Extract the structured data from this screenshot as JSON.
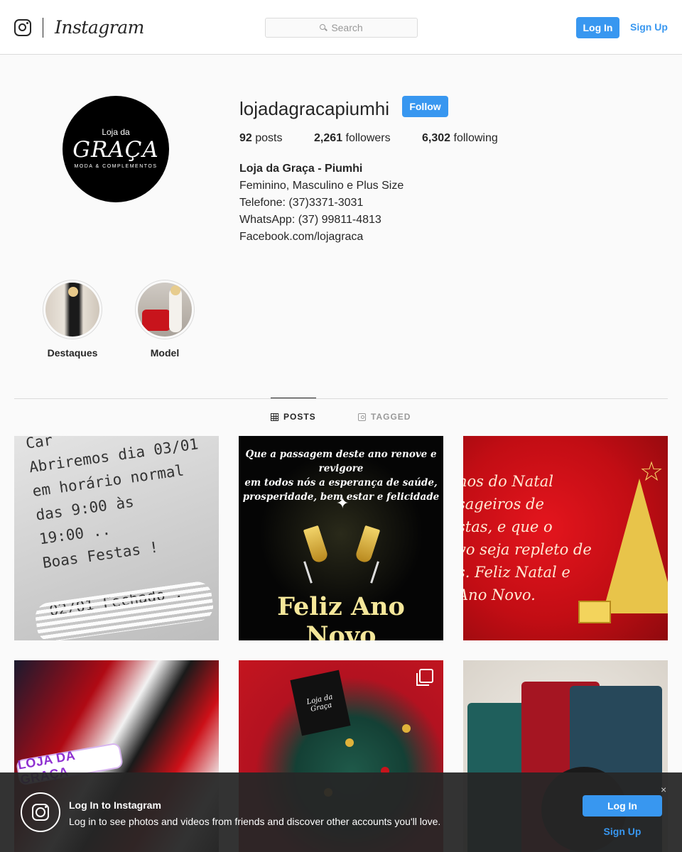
{
  "header": {
    "wordmark": "Instagram",
    "search_placeholder": "Search",
    "login_label": "Log In",
    "signup_label": "Sign Up"
  },
  "profile": {
    "avatar": {
      "line1": "Loja da",
      "line2": "GRAÇA",
      "line3": "MODA & COMPLEMENTOS"
    },
    "username": "lojadagracapiumhi",
    "follow_label": "Follow",
    "stats": [
      {
        "count": "92",
        "label": "posts"
      },
      {
        "count": "2,261",
        "label": "followers"
      },
      {
        "count": "6,302",
        "label": "following"
      }
    ],
    "bio": {
      "name": "Loja da Graça - Piumhi",
      "lines": [
        "Feminino, Masculino e Plus Size",
        "Telefone: (37)3371-3031",
        "WhatsApp: (37) 99811-4813",
        "Facebook.com/lojagraca"
      ]
    }
  },
  "highlights": [
    {
      "label": "Destaques"
    },
    {
      "label": "Model"
    }
  ],
  "tabs": [
    {
      "label": "POSTS",
      "active": true
    },
    {
      "label": "TAGGED",
      "active": false
    }
  ],
  "posts": {
    "p1_text": "Car\nAbriremos dia 03/01\nem horário normal\ndas 9:00 às\n19:00 ..\nBoas Festas !\n\n02/01 Fechado .",
    "p2_top": "Que a passagem deste ano renove e revigore\nem todos nós a esperança de saúde,\nprosperidade, bem estar e felicidade",
    "p2_bottom": "Feliz Ano Novo",
    "p3_text": "nos do Natal\nsageiros de\nstas, e que o\nvo seja repleto de\ns. Feliz Natal e\nAno Novo.",
    "p4_sticker": "LOJA DA GRAÇA",
    "p5_bag": "Loja da Graça"
  },
  "banner": {
    "title": "Log In to Instagram",
    "text": "Log in to see photos and videos from friends and discover other accounts you'll love.",
    "close": "×",
    "login_label": "Log In",
    "signup_label": "Sign Up"
  },
  "colors": {
    "accent": "#3897f0",
    "text": "#262626",
    "border": "#dbdbdb",
    "background": "#fafafa"
  }
}
